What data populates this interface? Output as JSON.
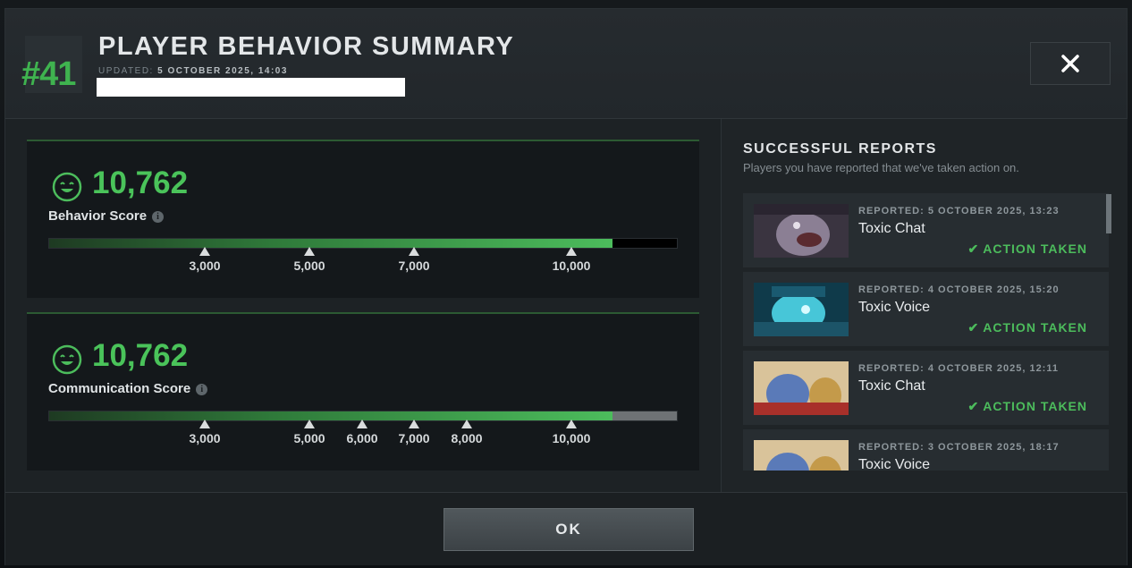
{
  "header": {
    "rank": "#41",
    "title": "PLAYER BEHAVIOR SUMMARY",
    "updated_label": "UPDATED:",
    "updated_value": "5 OCTOBER 2025, 14:03",
    "close_icon": "close-icon"
  },
  "behavior": {
    "score": "10,762",
    "label": "Behavior Score",
    "fill_fraction": 0.897,
    "ticks": [
      "3,000",
      "5,000",
      "7,000",
      "10,000"
    ]
  },
  "communication": {
    "score": "10,762",
    "label": "Communication Score",
    "fill_fraction": 0.897,
    "ticks": [
      "3,000",
      "5,000",
      "6,000",
      "7,000",
      "8,000",
      "10,000"
    ]
  },
  "reports": {
    "title": "SUCCESSFUL REPORTS",
    "subtitle": "Players you have reported that we've taken action on.",
    "items": [
      {
        "date": "REPORTED: 5 OCTOBER 2025, 13:23",
        "type": "Toxic Chat",
        "status": "ACTION TAKEN"
      },
      {
        "date": "REPORTED: 4 OCTOBER 2025, 15:20",
        "type": "Toxic Voice",
        "status": "ACTION TAKEN"
      },
      {
        "date": "REPORTED: 4 OCTOBER 2025, 12:11",
        "type": "Toxic Chat",
        "status": "ACTION TAKEN"
      },
      {
        "date": "REPORTED: 3 OCTOBER 2025, 18:17",
        "type": "Toxic Voice",
        "status": ""
      }
    ]
  },
  "footer": {
    "ok_label": "OK"
  },
  "colors": {
    "accent_green": "#4cbc5c",
    "rank_green": "#3fb34f",
    "background": "#1f2427"
  }
}
